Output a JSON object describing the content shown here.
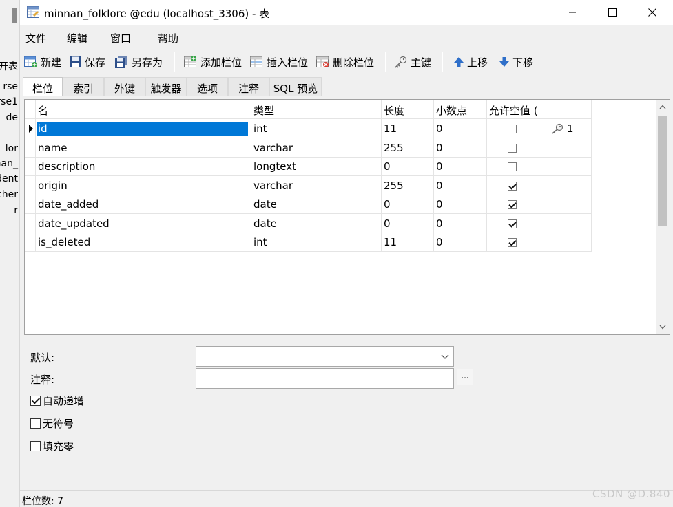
{
  "background_window": {
    "labels": [
      "开表",
      "rse",
      "rse1",
      "de",
      "lor",
      "nnan_",
      "dent",
      "cher",
      "r"
    ]
  },
  "window": {
    "title": "minnan_folklore @edu (localhost_3306) - 表",
    "minimize_icon": "minimize-icon",
    "maximize_icon": "maximize-icon",
    "close_icon": "close-icon"
  },
  "menu": [
    "文件",
    "编辑",
    "窗口",
    "帮助"
  ],
  "toolbar": {
    "new": "新建",
    "save": "保存",
    "save_as": "另存为",
    "add_field": "添加栏位",
    "insert_field": "插入栏位",
    "delete_field": "删除栏位",
    "primary_key": "主键",
    "move_up": "上移",
    "move_down": "下移"
  },
  "tabs": [
    "栏位",
    "索引",
    "外键",
    "触发器",
    "选项",
    "注释",
    "SQL 预览"
  ],
  "active_tab": "栏位",
  "grid": {
    "headers": [
      "名",
      "类型",
      "长度",
      "小数点",
      "允许空值 ("
    ],
    "rows": [
      {
        "name": "id",
        "type": "int",
        "length": "11",
        "decimals": "0",
        "nullable": false,
        "key": "1"
      },
      {
        "name": "name",
        "type": "varchar",
        "length": "255",
        "decimals": "0",
        "nullable": false,
        "key": ""
      },
      {
        "name": "description",
        "type": "longtext",
        "length": "0",
        "decimals": "0",
        "nullable": false,
        "key": ""
      },
      {
        "name": "origin",
        "type": "varchar",
        "length": "255",
        "decimals": "0",
        "nullable": true,
        "key": ""
      },
      {
        "name": "date_added",
        "type": "date",
        "length": "0",
        "decimals": "0",
        "nullable": true,
        "key": ""
      },
      {
        "name": "date_updated",
        "type": "date",
        "length": "0",
        "decimals": "0",
        "nullable": true,
        "key": ""
      },
      {
        "name": "is_deleted",
        "type": "int",
        "length": "11",
        "decimals": "0",
        "nullable": true,
        "key": ""
      }
    ],
    "selected_row": 0
  },
  "properties": {
    "default_label": "默认:",
    "default_value": "",
    "comment_label": "注释:",
    "comment_value": "",
    "ellipsis_label": "...",
    "auto_increment_label": "自动递增",
    "auto_increment": true,
    "unsigned_label": "无符号",
    "unsigned": false,
    "zerofill_label": "填充零",
    "zerofill": false
  },
  "status": {
    "field_count": "栏位数: 7"
  },
  "watermark": "CSDN @D.840",
  "colors": {
    "selection": "#0078d7",
    "window_bg": "#f0f0f0"
  }
}
